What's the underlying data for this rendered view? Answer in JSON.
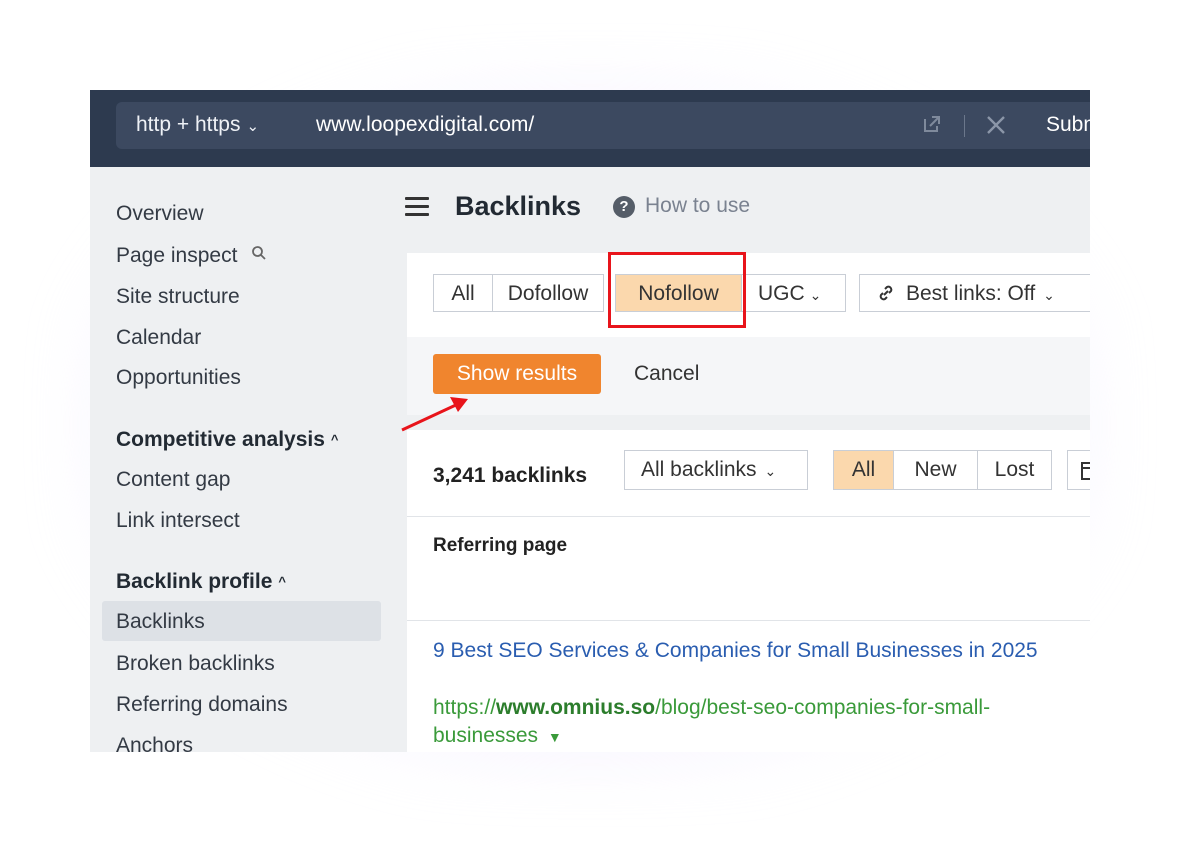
{
  "topbar": {
    "protocol": "http + https",
    "url": "www.loopexdigital.com/",
    "submit_label": "Subm"
  },
  "sidebar": {
    "items_top": [
      "Overview",
      "Page inspect",
      "Site structure",
      "Calendar",
      "Opportunities"
    ],
    "section_competitive": "Competitive analysis",
    "items_competitive": [
      "Content gap",
      "Link intersect"
    ],
    "section_backlink": "Backlink profile",
    "items_backlink": [
      "Backlinks",
      "Broken backlinks",
      "Referring domains",
      "Anchors"
    ],
    "active_item": "Backlinks"
  },
  "header": {
    "title": "Backlinks",
    "how_to_use": "How to use"
  },
  "filters": {
    "link_types": [
      "All",
      "Dofollow",
      "Nofollow",
      "UGC"
    ],
    "selected": "Nofollow",
    "best_links": "Best links: Off",
    "show_results": "Show results",
    "cancel": "Cancel"
  },
  "results": {
    "count": "3,241 backlinks",
    "dropdown": "All backlinks",
    "tabs": [
      "All",
      "New",
      "Lost"
    ],
    "selected_tab": "All",
    "column_header": "Referring page",
    "row": {
      "title": "9 Best SEO Services & Companies for Small Businesses in 2025",
      "url_prefix": "https://",
      "url_domain": "www.omnius.so",
      "url_path": "/blog/best-seo-companies-for-small-businesses"
    }
  },
  "colors": {
    "topbar": "#2d3a4f",
    "accent_orange": "#f0852e",
    "selected_fill": "#fbd8ad",
    "highlight_red": "#e8141b",
    "link_blue": "#2a5db0",
    "url_green": "#3a9a3a"
  }
}
